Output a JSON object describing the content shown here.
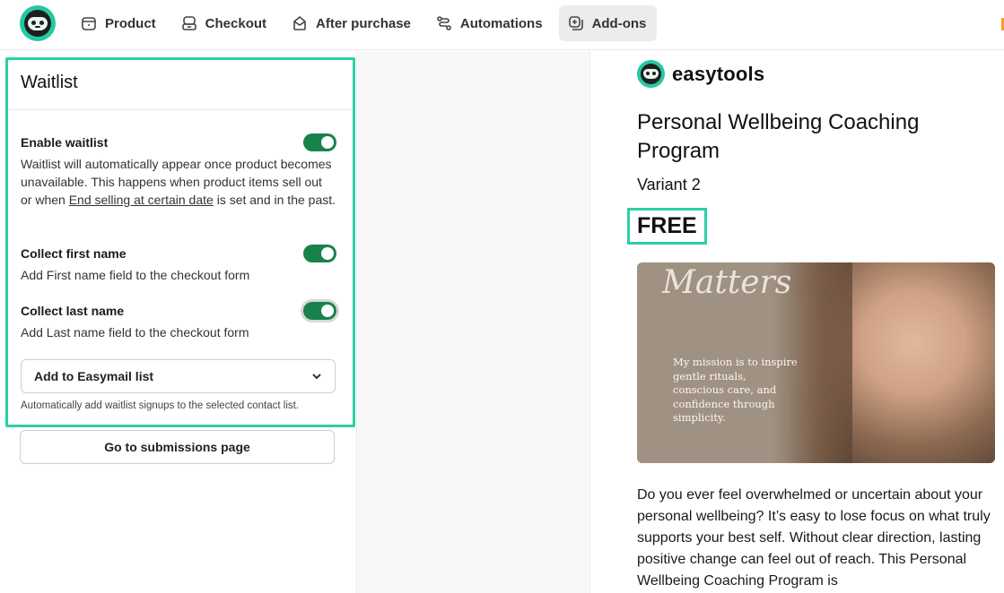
{
  "nav": {
    "items": [
      {
        "label": "Product",
        "icon": "box-icon"
      },
      {
        "label": "Checkout",
        "icon": "checkout-icon"
      },
      {
        "label": "After purchase",
        "icon": "after-purchase-icon"
      },
      {
        "label": "Automations",
        "icon": "automations-icon"
      },
      {
        "label": "Add-ons",
        "icon": "add-ons-icon",
        "active": true
      }
    ]
  },
  "waitlist": {
    "title": "Waitlist",
    "enable": {
      "label": "Enable waitlist",
      "desc_before": "Waitlist will automatically appear once product becomes unavailable. This happens when product items sell out or when ",
      "desc_link": "End selling at certain date",
      "desc_after": " is set and in the past.",
      "enabled": true
    },
    "first_name": {
      "label": "Collect first name",
      "desc": "Add First name field to the checkout form",
      "enabled": true
    },
    "last_name": {
      "label": "Collect last name",
      "desc": "Add Last name field to the checkout form",
      "enabled": true
    },
    "easymail": {
      "label": "Add to Easymail list",
      "hint": "Automatically add waitlist signups to the selected contact list."
    }
  },
  "submissions_button": "Go to submissions page",
  "preview": {
    "brand": "easytools",
    "product_title": "Personal Wellbeing Coaching Program",
    "variant": "Variant 2",
    "price": "FREE",
    "image": {
      "script_text": "Matters",
      "caption": "My mission is to inspire gentle rituals, conscious care, and confidence through simplicity."
    },
    "description": "Do you ever feel overwhelmed or uncertain about your personal wellbeing? It’s easy to lose focus on what truly supports your best self. Without clear direction, lasting positive change can feel out of reach. This Personal Wellbeing Coaching Program is"
  },
  "colors": {
    "accent": "#2bd0a6",
    "toggle_on": "#17834a"
  }
}
